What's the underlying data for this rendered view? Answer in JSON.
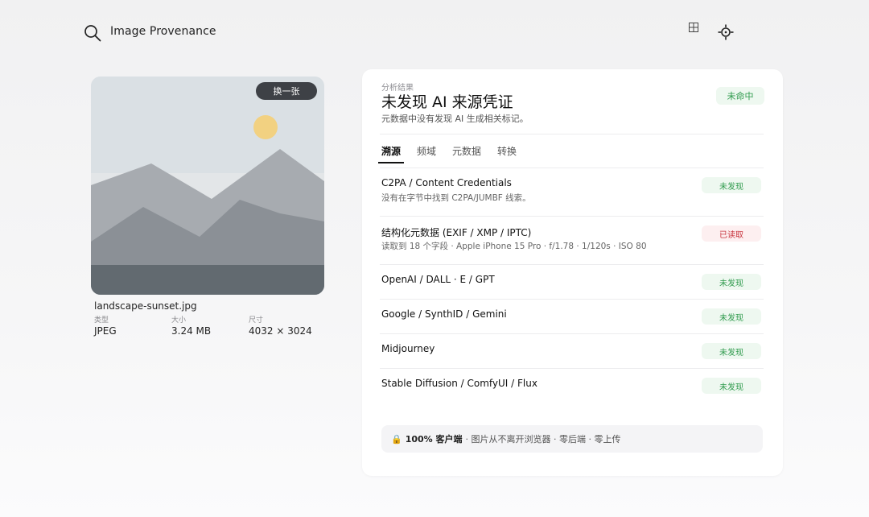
{
  "header": {
    "title": "Image Provenance",
    "search_icon": "search-icon",
    "grid_icon": "grid-icon",
    "target_icon": "crosshair-icon"
  },
  "image_card": {
    "change_label": "换一张",
    "file_name": "landscape-sunset.jpg",
    "meta": [
      {
        "label": "类型",
        "value": "JPEG"
      },
      {
        "label": "大小",
        "value": "3.24 MB"
      },
      {
        "label": "尺寸",
        "value": "4032 × 3024"
      }
    ]
  },
  "result": {
    "eyebrow": "分析结果",
    "heading": "未发现 AI 来源凭证",
    "subtitle": "元数据中没有发现 AI 生成相关标记。",
    "badge": "未命中"
  },
  "tabs": [
    "溯源",
    "频域",
    "元数据",
    "转换"
  ],
  "checks": [
    {
      "title": "C2PA / Content Credentials",
      "desc": "没有在字节中找到 C2PA/JUMBF 线索。",
      "status": "未发现",
      "state": "ok"
    },
    {
      "title": "结构化元数据 (EXIF / XMP / IPTC)",
      "desc": "读取到 18 个字段 · Apple iPhone 15 Pro · f/1.78 · 1/120s · ISO 80",
      "status": "已读取",
      "state": "warn"
    },
    {
      "title": "OpenAI / DALL · E / GPT",
      "desc": "",
      "status": "未发现",
      "state": "ok"
    },
    {
      "title": "Google / SynthID / Gemini",
      "desc": "",
      "status": "未发现",
      "state": "ok"
    },
    {
      "title": "Midjourney",
      "desc": "",
      "status": "未发现",
      "state": "ok"
    },
    {
      "title": "Stable Diffusion / ComfyUI / Flux",
      "desc": "",
      "status": "未发现",
      "state": "ok"
    }
  ],
  "footer": {
    "lock_icon": "lock-icon",
    "strong": "100% 客户端",
    "rest": "· 图片从不离开浏览器 · 零后端 · 零上传"
  },
  "colors": {
    "ok_text": "#2e9a4c",
    "ok_bg": "#eef8f0",
    "warn_text": "#c8353e",
    "warn_bg": "#fdeff0",
    "button_bg": "#3e4146"
  }
}
